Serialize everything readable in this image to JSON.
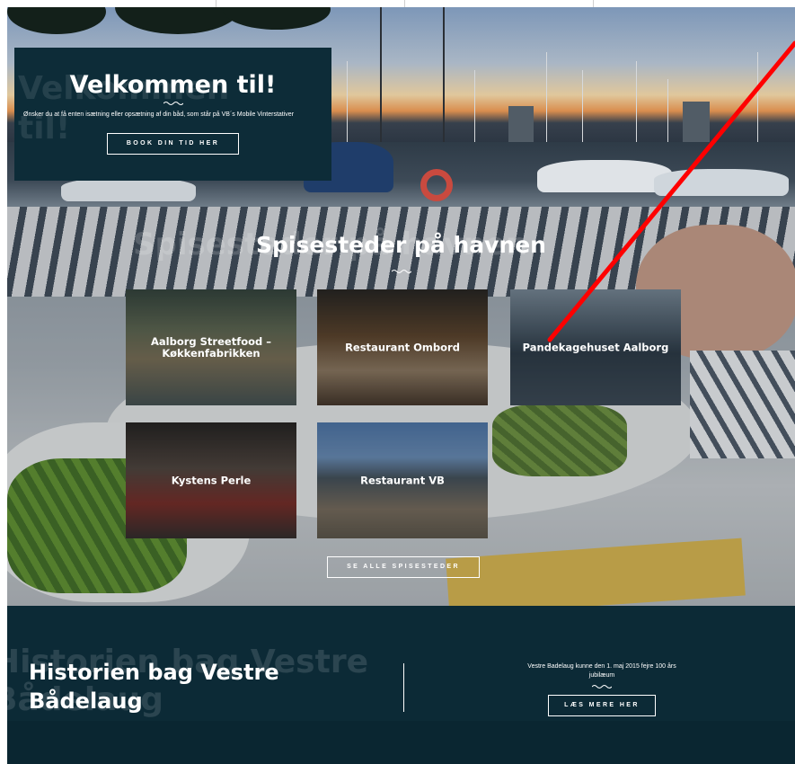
{
  "hero": {
    "ghost_text": "Velkommen til!",
    "title": "Velkommen til!",
    "description": "Ønsker du at få enten isætning eller opsætning af din båd, som står på VB´s Mobile Vinterstativer",
    "button_label": "BOOK DIN TID HER"
  },
  "restaurants": {
    "ghost_text": "Spisesteder på havnen",
    "title": "Spisesteder på havnen",
    "cards": [
      {
        "label": "Aalborg Streetfood – Køkkenfabrikken"
      },
      {
        "label": "Restaurant Ombord"
      },
      {
        "label": "Pandekagehuset Aalborg"
      },
      {
        "label": "Kystens Perle"
      },
      {
        "label": "Restaurant VB"
      }
    ],
    "button_label": "SE ALLE SPISESTEDER"
  },
  "history": {
    "ghost_text": "Historien bag Vestre Bådelaug",
    "title": "Historien bag Vestre Bådelaug",
    "description": "Vestre Badelaug kunne den 1. maj 2015 fejre 100 års jubilæum",
    "button_label": "LÆS MERE HER"
  },
  "colors": {
    "dark_teal": "#0c2a36",
    "annotation_red": "#ff0000",
    "text_white": "#ffffff"
  },
  "icons": [
    "wave-divider-icon"
  ]
}
